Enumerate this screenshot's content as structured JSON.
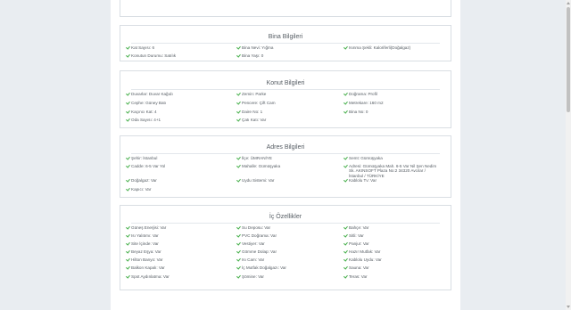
{
  "bina": {
    "title": "Bina Bilgileri",
    "items": [
      "Kat Sayısı: 6",
      "Bina Nevi: Yığma",
      "Isınma Şekli: Kaloriferli(Doğalgaz)",
      "Konutun Durumu: Satılık",
      "Bina Yaşı: 0"
    ]
  },
  "konut": {
    "title": "Konut Bilgileri",
    "items": [
      "Duvarlar: Duvar Kağıdı",
      "Zemin: Parke",
      "Doğrama: Profil",
      "Cephe: Güney Batı",
      "Pencere: Çift Cam",
      "Metrekare: 160 m2",
      "Kaçıncı Kat: 4",
      "Daire No: 1",
      "Bina No: 0",
      "Oda Sayısı: 4+1",
      "Çatı Katı: Var"
    ]
  },
  "adres": {
    "title": "Adres Bilgileri",
    "items": [
      "Şehir: İstanbul",
      "İlçe: ÜMRANİYE",
      "Semt: Gümüşyaka",
      "Cadde: 6-5 Var Yol",
      "Mahalle: Gümüşyaka",
      "Adresi: Gümüşyaka Mah. 6-5 Var Nil Şen Nedim Sk. AKINSOFT Plaza No:2 34320 Avcılar / İstanbul / TÜRKİYE",
      "Doğalgaz: Var",
      "Uydu Sistemi: Var",
      "Kablolu Tv: Var",
      "Kapıcı: Var"
    ]
  },
  "ic": {
    "title": "İç Özellikler",
    "items": [
      "Güneş Enerjisi: Var",
      "Su Deposu: Var",
      "Bahçe: Var",
      "Isı Yalıtımı: Var",
      "PVC Doğrama: Var",
      "Sitli: Var",
      "Site İçinde: Var",
      "Vestiyer: Var",
      "Panjur: Var",
      "Beyaz Eşya: Var",
      "Gömme Dolap: Var",
      "Hazır Mutfak: Var",
      "Hilton Banyo: Var",
      "Isı Cam: Var",
      "Kablolu Uydu: Var",
      "Balkon Kapalı: Var",
      "İç Mutfak Doğalgazı: Var",
      "Sauna: Var",
      "Spot Aydınlatma: Var",
      "Şömine: Var",
      "Teras: Var"
    ]
  }
}
